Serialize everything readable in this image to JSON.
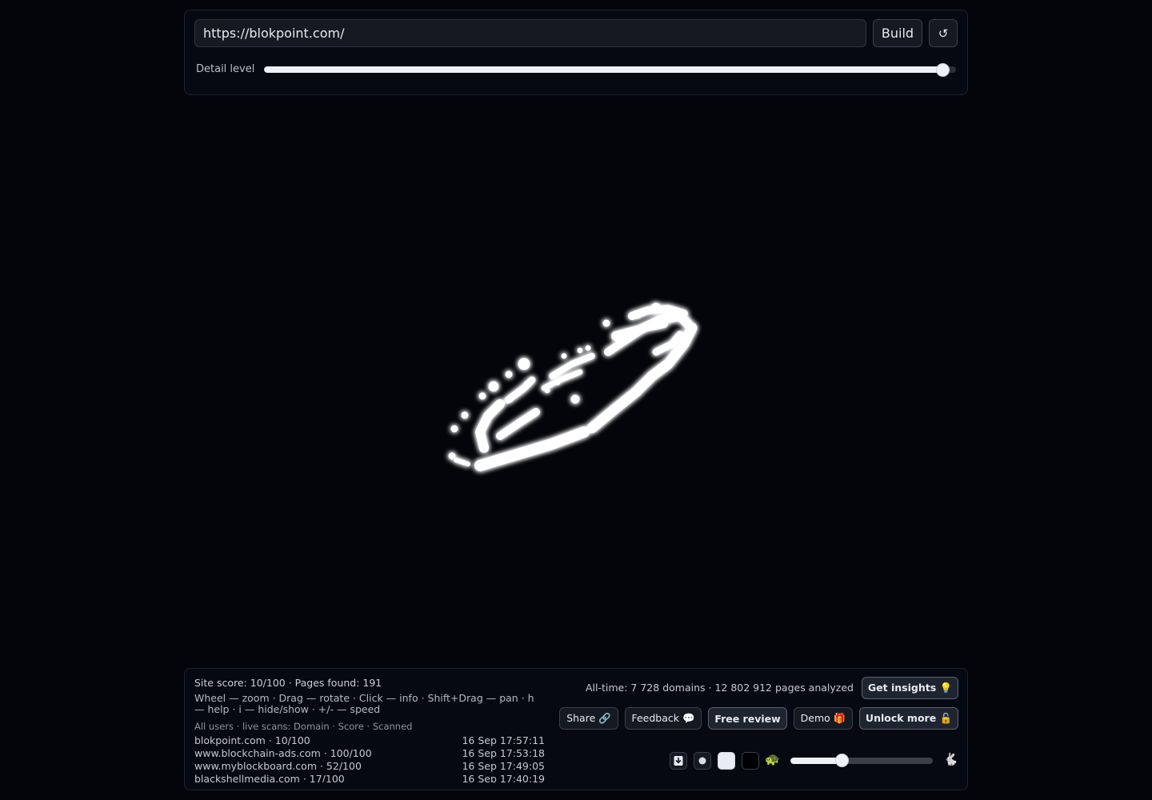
{
  "toolbar": {
    "url_value": "https://blokpoint.com/",
    "build_label": "Build",
    "reload_icon": "↺",
    "detail_label": "Detail level",
    "detail_level": 0.98
  },
  "visualization": {
    "glow_color": "#ffffff",
    "background": "#03050a"
  },
  "stats": {
    "site_score_line": "Site score: 10/100 · Pages found: 191",
    "help_text": "Wheel — zoom · Drag — rotate · Click — info · Shift+Drag — pan · h — help · i — hide/show · +/- — speed",
    "all_time": "All-time: 7 728 domains · 12 802 912 pages analyzed"
  },
  "scans": {
    "header": "All users · live scans: Domain · Score · Scanned",
    "rows": [
      {
        "domain": "blokpoint.com · 10/100",
        "time": "16 Sep 17:57:11"
      },
      {
        "domain": "www.blockchain-ads.com · 100/100",
        "time": "16 Sep 17:53:18"
      },
      {
        "domain": "www.myblockboard.com · 52/100",
        "time": "16 Sep 17:49:05"
      },
      {
        "domain": "blackshellmedia.com · 17/100",
        "time": "16 Sep 17:40:19"
      }
    ]
  },
  "actions": {
    "insights_label": "Get insights 💡",
    "share_label": "Share 🔗",
    "feedback_label": "Feedback 💬",
    "review_label": "Free review",
    "demo_label": "Demo 🎁",
    "unlock_label": "Unlock more 🔓"
  },
  "controls": {
    "download_icon": "download-icon",
    "dot_icon": "dot-icon",
    "turtle_icon": "🐢",
    "rabbit_icon": "🐇",
    "speed_level": 0.36
  }
}
